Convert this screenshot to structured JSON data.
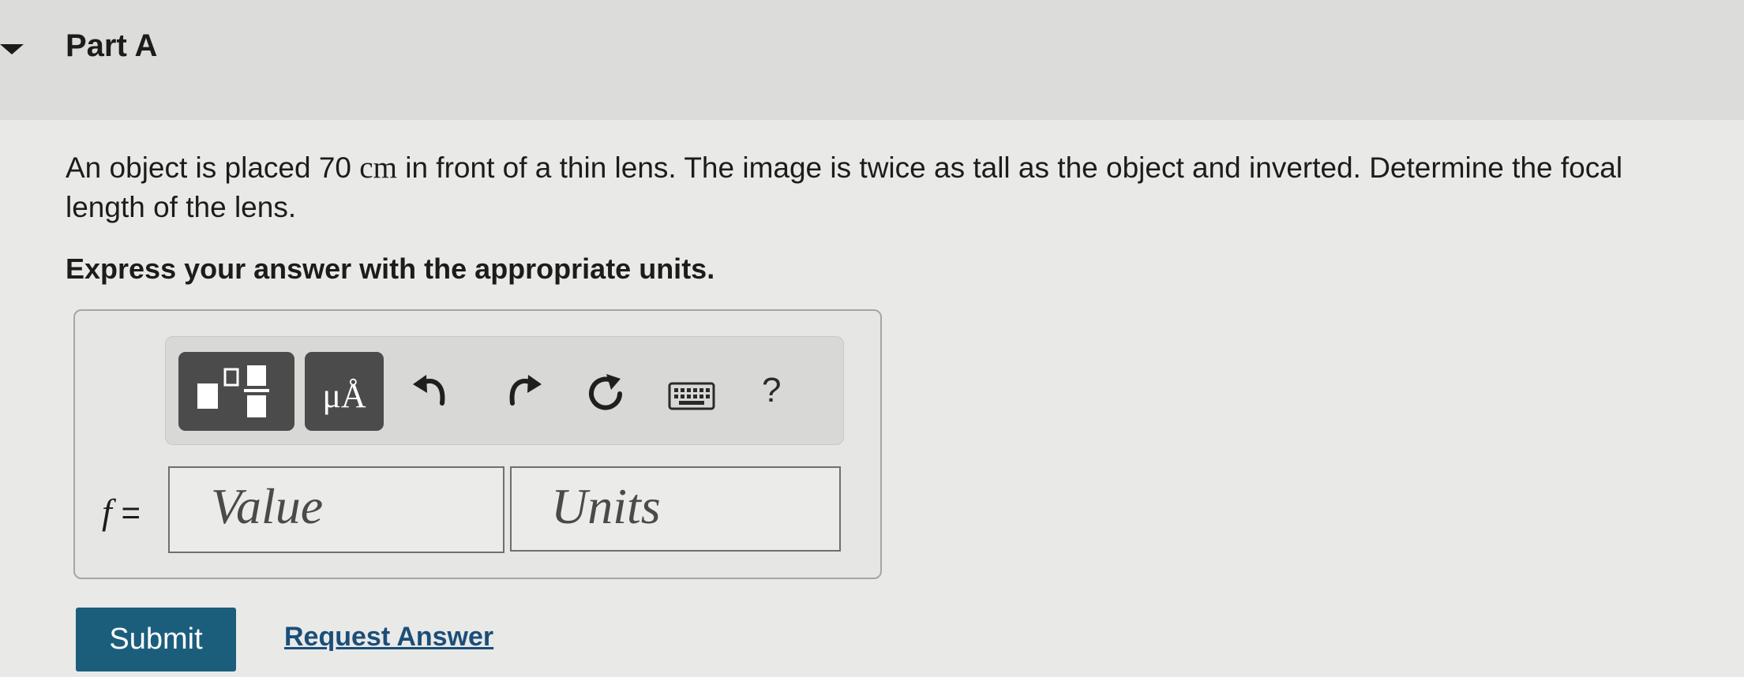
{
  "part": {
    "title": "Part A"
  },
  "question": {
    "text_before": "An object is placed 70 ",
    "unit": "cm",
    "text_after": " in front of a thin lens. The image is twice as tall as the object and inverted. Determine the focal length of the lens.",
    "instruction": "Express your answer with the appropriate units."
  },
  "toolbar": {
    "templates_icon": "templates-icon",
    "units_label": "μÅ",
    "undo_icon": "undo-arrow-icon",
    "redo_icon": "redo-arrow-icon",
    "reset_icon": "reset-icon",
    "keyboard_icon": "keyboard-icon",
    "help_label": "?"
  },
  "answer": {
    "variable": "f",
    "equals": " =",
    "value_placeholder": "Value",
    "units_placeholder": "Units"
  },
  "actions": {
    "submit_label": "Submit",
    "request_answer_label": "Request Answer"
  },
  "colors": {
    "submit_bg": "#1b5e7c",
    "link": "#1b4e79",
    "tool_button_bg": "#4b4b4b"
  }
}
